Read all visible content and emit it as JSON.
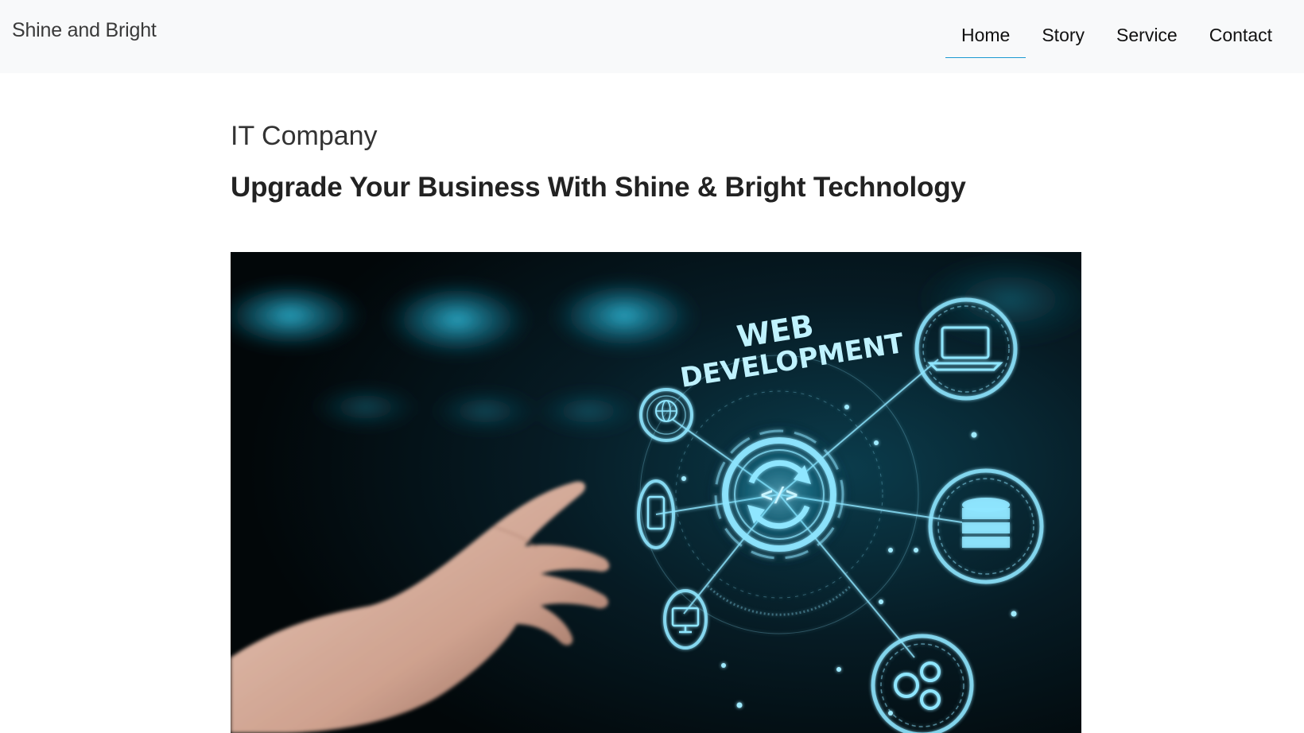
{
  "navbar": {
    "brand": "Shine and Bright",
    "links": [
      {
        "label": "Home",
        "active": true
      },
      {
        "label": "Story",
        "active": false
      },
      {
        "label": "Service",
        "active": false
      },
      {
        "label": "Contact",
        "active": false
      }
    ]
  },
  "main": {
    "subtitle": "IT Company",
    "headline": "Upgrade Your Business With Shine & Bright Technology"
  },
  "hero_image": {
    "caption_line1": "WEB",
    "caption_line2": "DEVELOPMENT",
    "center_glyph": "</>",
    "icons": [
      "globe-icon",
      "laptop-icon",
      "phone-icon",
      "database-icon",
      "monitor-icon",
      "gears-icon",
      "refresh-code-icon"
    ]
  },
  "colors": {
    "nav_bg": "#f8f9fa",
    "active_underline": "#1b9ad1",
    "hero_glow": "#33c3e6"
  }
}
